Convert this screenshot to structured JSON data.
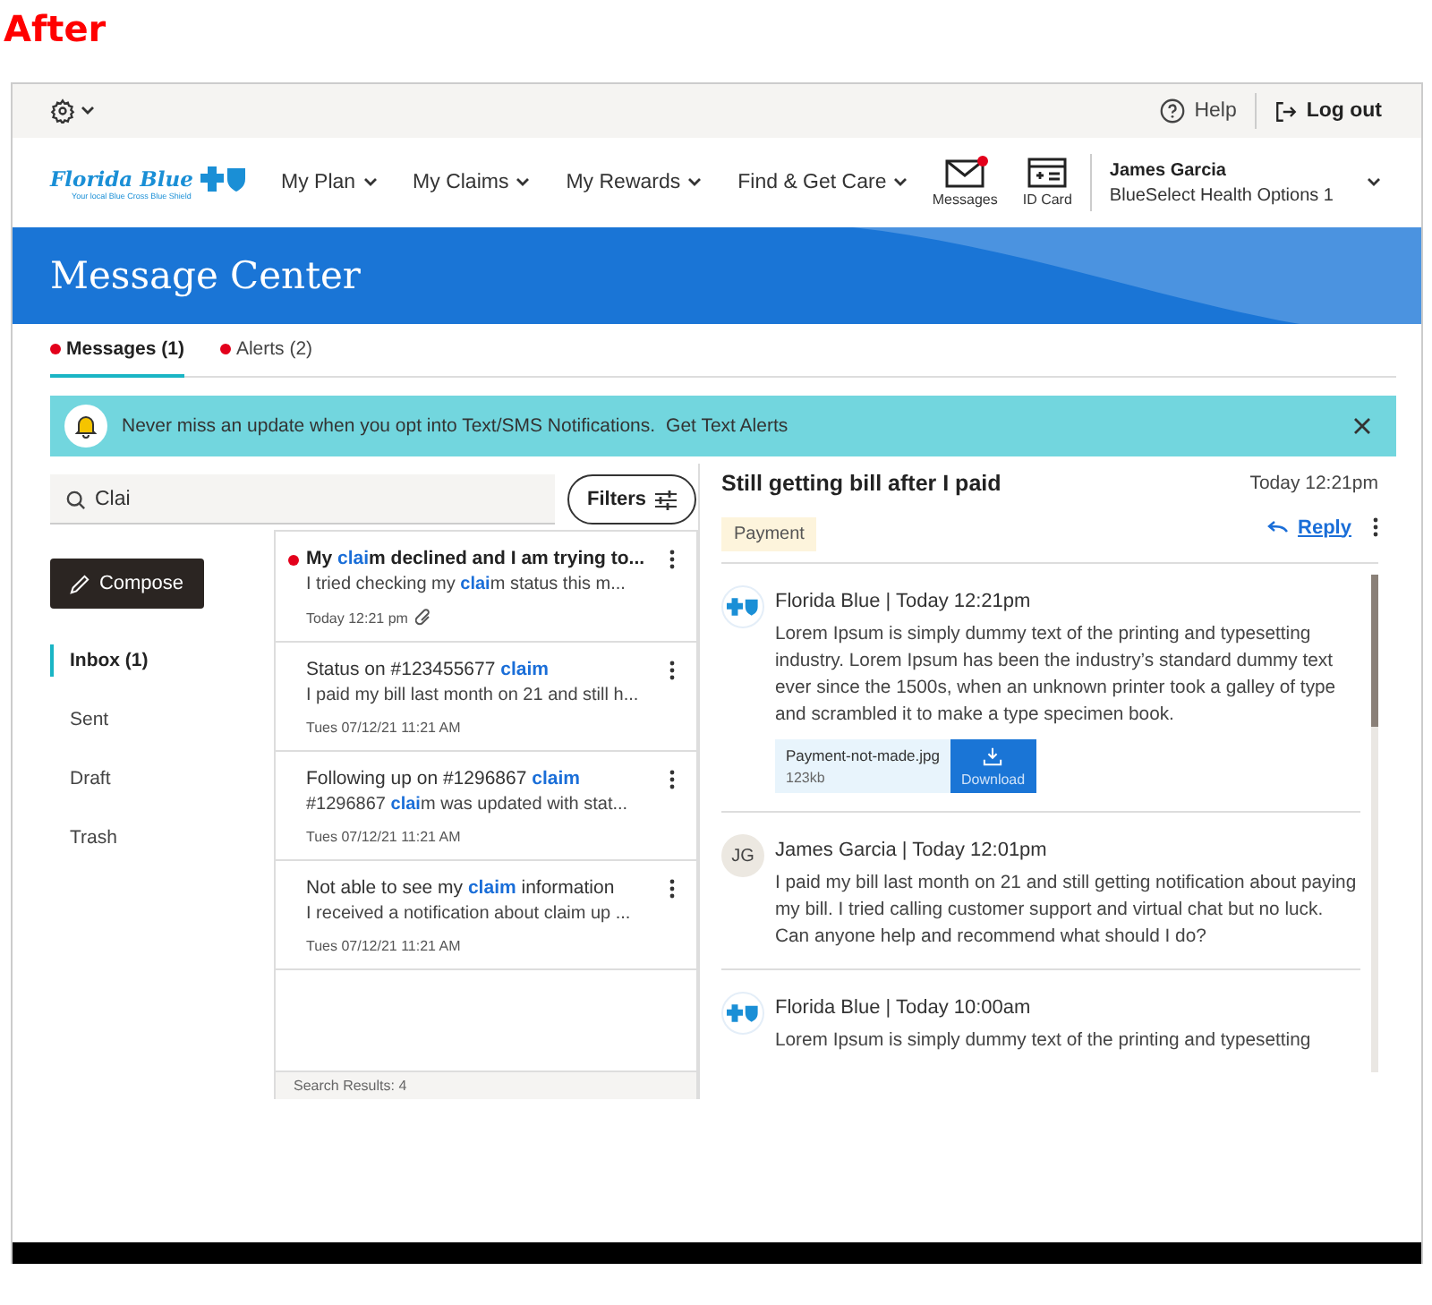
{
  "label": "After",
  "utility": {
    "help": "Help",
    "logout": "Log out"
  },
  "header": {
    "logo": {
      "name": "Florida Blue",
      "tagline": "Your local Blue Cross Blue Shield"
    },
    "nav": [
      {
        "label": "My Plan"
      },
      {
        "label": "My Claims"
      },
      {
        "label": "My Rewards"
      },
      {
        "label": "Find & Get Care"
      }
    ],
    "shortcuts": [
      {
        "label": "Messages",
        "kind": "mail",
        "badge": true
      },
      {
        "label": "ID Card",
        "kind": "card",
        "badge": false
      }
    ],
    "user": {
      "name": "James Garcia",
      "plan": "BlueSelect Health Options 1"
    }
  },
  "banner": {
    "title": "Message Center"
  },
  "tabs": [
    {
      "label": "Messages (1)",
      "selected": true,
      "dot": true
    },
    {
      "label": "Alerts (2)",
      "selected": false,
      "dot": true
    }
  ],
  "notice": {
    "text": "Never miss an update when you opt into Text/SMS Notifications.",
    "link": "Get Text Alerts"
  },
  "search": {
    "value": "Clai"
  },
  "filters": "Filters",
  "compose": "Compose",
  "folders": [
    {
      "label": "Inbox (1)",
      "selected": true
    },
    {
      "label": "Sent",
      "selected": false
    },
    {
      "label": "Draft",
      "selected": false
    },
    {
      "label": "Trash",
      "selected": false
    }
  ],
  "messages": [
    {
      "unread": true,
      "attachment": true,
      "date": "Today 12:21 pm",
      "title": [
        {
          "text": "My ",
          "match": false
        },
        {
          "text": "clai",
          "match": true
        },
        {
          "text": "m declined and I am trying to...",
          "match": false
        }
      ],
      "preview": [
        {
          "text": "I tried checking my ",
          "match": false
        },
        {
          "text": "clai",
          "match": true
        },
        {
          "text": "m status this m...",
          "match": false
        }
      ]
    },
    {
      "unread": false,
      "attachment": false,
      "date": "Tues 07/12/21 11:21 AM",
      "title": [
        {
          "text": "Status on #123455677 ",
          "match": false
        },
        {
          "text": "claim",
          "match": true
        }
      ],
      "preview": [
        {
          "text": "I paid my bill last month on 21 and still h...",
          "match": false
        }
      ]
    },
    {
      "unread": false,
      "attachment": false,
      "date": "Tues 07/12/21 11:21 AM",
      "title": [
        {
          "text": "Following up on #1296867 ",
          "match": false
        },
        {
          "text": "claim",
          "match": true
        }
      ],
      "preview": [
        {
          "text": "#1296867 ",
          "match": false
        },
        {
          "text": "clai",
          "match": true
        },
        {
          "text": "m was updated with stat...",
          "match": false
        }
      ]
    },
    {
      "unread": false,
      "attachment": false,
      "date": "Tues 07/12/21 11:21 AM",
      "title": [
        {
          "text": "Not able to see my ",
          "match": false
        },
        {
          "text": "claim",
          "match": true
        },
        {
          "text": " information",
          "match": false
        }
      ],
      "preview": [
        {
          "text": "I received a notification about claim up ...",
          "match": false
        }
      ]
    }
  ],
  "search_results": "Search Results: 4",
  "thread": {
    "subject": "Still getting bill after I paid",
    "date": "Today 12:21pm",
    "tag": "Payment",
    "reply": "Reply",
    "posts": [
      {
        "kind": "logo",
        "header": "Florida Blue | Today 12:21pm",
        "body": "Lorem Ipsum is simply dummy text of the printing and typesetting industry. Lorem Ipsum has been the industry’s standard dummy text ever since the 1500s, when an unknown printer took a galley of type and scrambled it to make a type specimen book.",
        "attachment": {
          "name": "Payment-not-made.jpg",
          "size": "123kb",
          "action": "Download"
        }
      },
      {
        "kind": "initials",
        "initials": "JG",
        "header": "James Garcia | Today 12:01pm",
        "body": "I paid my bill last month on 21 and still getting notification about paying my bill. I tried calling customer support and virtual chat but no luck. Can anyone help and recommend what should I do?"
      },
      {
        "kind": "logo",
        "header": "Florida Blue | Today 10:00am",
        "body": "Lorem Ipsum is simply dummy text of the printing and typesetting"
      }
    ]
  }
}
